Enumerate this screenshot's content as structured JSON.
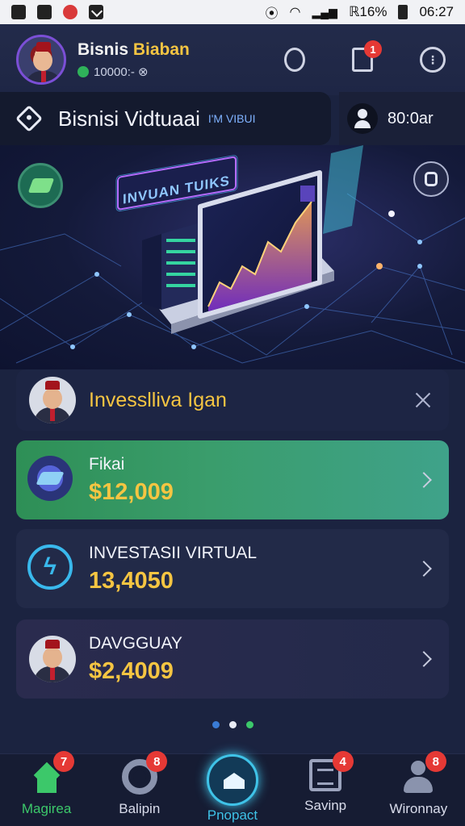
{
  "status_bar": {
    "right_text": "ℝ16%",
    "time": "06:27"
  },
  "header": {
    "user_name_part1": "Bisnis",
    "user_name_part2": "Biaban",
    "user_sub": "10000:- ⊗",
    "doc_badge": "1"
  },
  "title_bar": {
    "title": "Bisnisi Vidtuaai",
    "subtitle": "I'M VIBUI",
    "account_label": "80:0ar"
  },
  "banner": {
    "sign_text": "INVUAN TUIKS"
  },
  "cards": [
    {
      "title": "Invesslliva Igan"
    },
    {
      "label": "Fikai",
      "value": "$12,009"
    },
    {
      "label": "INVESTASII VIRTUAL",
      "value": "13,4050"
    },
    {
      "label": "DAVGGUAY",
      "value": "$2,4009"
    }
  ],
  "nav": [
    {
      "label": "Magirea",
      "badge": "7",
      "color": "#3cc86a"
    },
    {
      "label": "Balipin",
      "badge": "8",
      "color": "#d9dceb"
    },
    {
      "label": "Pnopact",
      "badge": "",
      "color": "#3fc3e8"
    },
    {
      "label": "Savinp",
      "badge": "4",
      "color": "#d9dceb"
    },
    {
      "label": "Wironnay",
      "badge": "8",
      "color": "#d9dceb"
    }
  ],
  "dots": [
    "#3a7bd5",
    "#e8ebf5",
    "#3cc86a"
  ]
}
